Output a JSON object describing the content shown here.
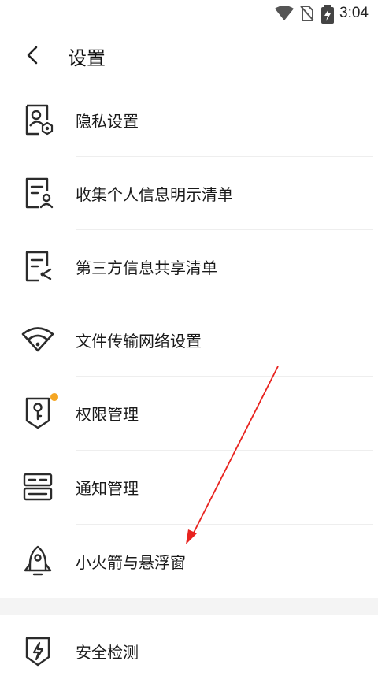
{
  "status_bar": {
    "time": "3:04"
  },
  "header": {
    "title": "设置"
  },
  "settings_items": [
    {
      "label": "隐私设置",
      "icon": "privacy-person-icon"
    },
    {
      "label": "收集个人信息明示清单",
      "icon": "personal-info-list-icon"
    },
    {
      "label": "第三方信息共享清单",
      "icon": "third-party-share-icon"
    },
    {
      "label": "文件传输网络设置",
      "icon": "wifi-icon"
    },
    {
      "label": "权限管理",
      "icon": "key-shield-icon",
      "badge": true
    },
    {
      "label": "通知管理",
      "icon": "notification-panel-icon"
    },
    {
      "label": "小火箭与悬浮窗",
      "icon": "rocket-icon"
    },
    {
      "label": "安全检测",
      "icon": "lightning-shield-icon"
    }
  ],
  "colors": {
    "badge": "#f5a623",
    "annotation_arrow": "#e8231f",
    "icon": "#2b2b2b"
  }
}
